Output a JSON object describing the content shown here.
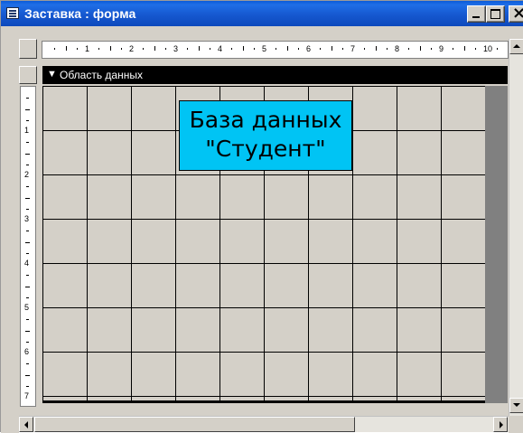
{
  "window": {
    "title": "Заставка : форма",
    "app_icon": "form-icon",
    "controls": [
      "minimize-icon",
      "maximize-icon",
      "close-icon"
    ]
  },
  "rulers": {
    "horizontal_labels": [
      "1",
      "2",
      "3",
      "4",
      "5",
      "6",
      "7",
      "8",
      "9",
      "10"
    ],
    "vertical_labels": [
      "1",
      "2",
      "3",
      "4",
      "5",
      "6",
      "7"
    ]
  },
  "section": {
    "icon": "section-arrow-icon",
    "label": "Область данных"
  },
  "label_control": {
    "line1": "База данных",
    "line2": "\"Студент\"",
    "background": "#00c4f4"
  },
  "colors": {
    "title_bar": "#1658d0",
    "workspace": "#d4d0c8",
    "outside_area": "#808080"
  }
}
